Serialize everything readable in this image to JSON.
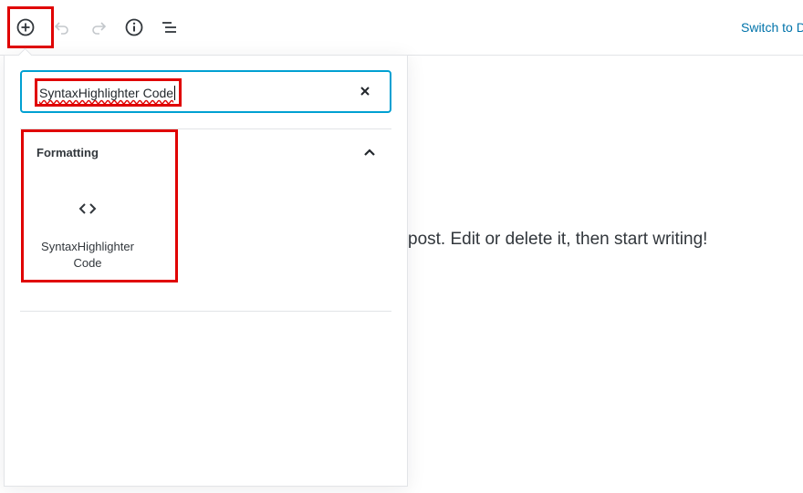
{
  "toolbar": {
    "add_block_icon": "plus-circle-icon",
    "undo_icon": "undo-icon",
    "redo_icon": "redo-icon",
    "info_icon": "info-icon",
    "outline_icon": "list-view-icon",
    "switch_link": "Switch to D"
  },
  "editor": {
    "body_text": "post. Edit or delete it, then start writing!"
  },
  "inserter": {
    "search": {
      "value": "SyntaxHighlighter Code",
      "clear_icon": "close-icon"
    },
    "panel": {
      "title": "Formatting",
      "toggle_icon": "chevron-up-icon",
      "blocks": [
        {
          "label": "SyntaxHighlighter\nCode",
          "icon": "code-brackets-icon"
        }
      ]
    }
  },
  "colors": {
    "accent": "#0073aa",
    "focus_border": "#00a0d2",
    "annotation_red": "#e00000",
    "text": "#32373c"
  }
}
